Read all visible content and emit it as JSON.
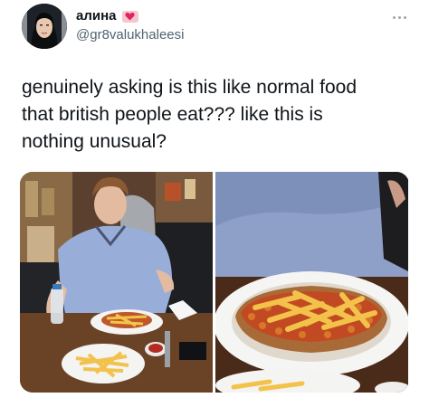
{
  "author": {
    "display_name": "алина",
    "handle": "@gr8valukhaleesi",
    "badge_icon": "heart-icon",
    "avatar_icon": "profile-photo"
  },
  "menu": {
    "icon": "more-horizontal-icon"
  },
  "tweet": {
    "text": "genuinely asking is this like normal food\nthat british people eat??? like this is\nnothing unusual?"
  },
  "media": {
    "photos": [
      {
        "icon": "photo-man-with-beans-on-toast"
      },
      {
        "icon": "photo-beans-on-toast-closeup"
      }
    ]
  },
  "colors": {
    "text": "#0f1419",
    "secondary_text": "#536471",
    "badge_bg": "#f4c6cf",
    "heart": "#e0245e"
  }
}
